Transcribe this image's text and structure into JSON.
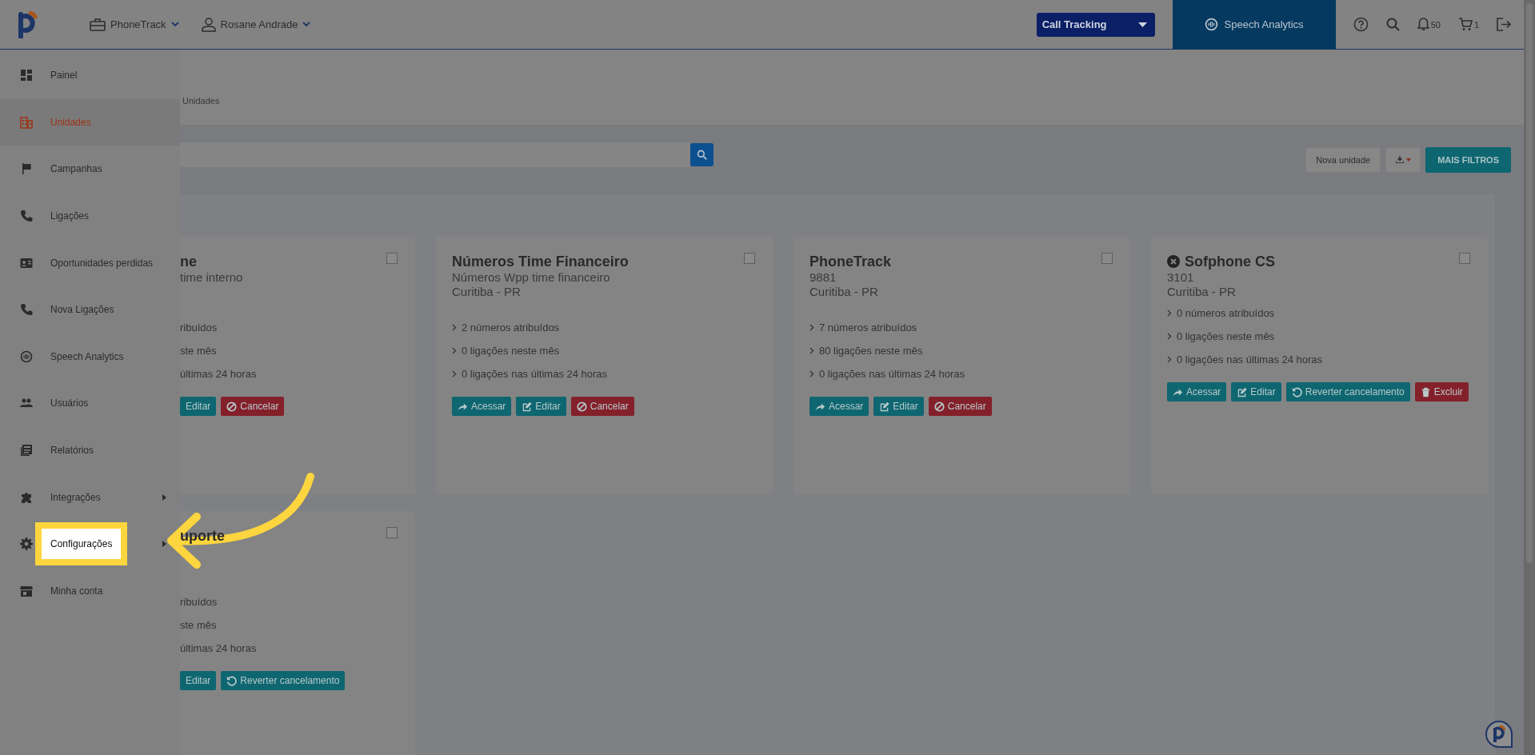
{
  "header": {
    "account": "PhoneTrack",
    "user": "Rosane Andrade",
    "product_select": "Call Tracking",
    "speech_analytics": "Speech Analytics",
    "notifications": "50",
    "cart": "1"
  },
  "sidebar": {
    "items": [
      {
        "label": "Painel",
        "selected": false,
        "submenu": false,
        "highlighted": false
      },
      {
        "label": "Unidades",
        "selected": true,
        "submenu": false,
        "highlighted": false
      },
      {
        "label": "Campanhas",
        "selected": false,
        "submenu": false,
        "highlighted": false
      },
      {
        "label": "Ligações",
        "selected": false,
        "submenu": false,
        "highlighted": false
      },
      {
        "label": "Oportunidades perdidas",
        "selected": false,
        "submenu": false,
        "highlighted": false
      },
      {
        "label": "Nova Ligações",
        "selected": false,
        "submenu": false,
        "highlighted": false
      },
      {
        "label": "Speech Analytics",
        "selected": false,
        "submenu": false,
        "highlighted": false
      },
      {
        "label": "Usuários",
        "selected": false,
        "submenu": false,
        "highlighted": false
      },
      {
        "label": "Relatórios",
        "selected": false,
        "submenu": false,
        "highlighted": false
      },
      {
        "label": "Integrações",
        "selected": false,
        "submenu": true,
        "highlighted": false
      },
      {
        "label": "Configurações",
        "selected": false,
        "submenu": true,
        "highlighted": true
      },
      {
        "label": "Minha conta",
        "selected": false,
        "submenu": false,
        "highlighted": false
      }
    ]
  },
  "breadcrumb": "Unidades",
  "toolbar": {
    "new_button": "Nova unidade",
    "filters_button": "MAIS FILTROS"
  },
  "cards": [
    {
      "kind": "partial",
      "title": "ne",
      "subtitle": "time interno",
      "cancelled": false,
      "checked": false,
      "stats": [
        "ribuídos",
        "ste mês",
        "últimas 24 horas"
      ],
      "buttons": [
        {
          "kind": "edit",
          "label": "Editar"
        },
        {
          "kind": "cancel",
          "label": "Cancelar"
        }
      ]
    },
    {
      "kind": "full",
      "title": "Números Time Financeiro",
      "subtitle": "Números Wpp time financeiro",
      "location": "Curitiba - PR",
      "cancelled": false,
      "checked": false,
      "stats": [
        "2 números atribuídos",
        "0 ligações neste mês",
        "0 ligações nas últimas 24 horas"
      ],
      "buttons": [
        {
          "kind": "access",
          "label": "Acessar"
        },
        {
          "kind": "edit",
          "label": "Editar"
        },
        {
          "kind": "cancel",
          "label": "Cancelar"
        }
      ]
    },
    {
      "kind": "full",
      "title": "PhoneTrack",
      "subtitle": "9881",
      "location": "Curitiba - PR",
      "cancelled": false,
      "checked": false,
      "stats": [
        "7 números atribuídos",
        "80 ligações neste mês",
        "0 ligações nas últimas 24 horas"
      ],
      "buttons": [
        {
          "kind": "access",
          "label": "Acessar"
        },
        {
          "kind": "edit",
          "label": "Editar"
        },
        {
          "kind": "cancel",
          "label": "Cancelar"
        }
      ]
    },
    {
      "kind": "full",
      "title": "Sofphone CS",
      "subtitle": "3101",
      "location": "Curitiba - PR",
      "cancelled": true,
      "checked": false,
      "stats": [
        "0 números atribuídos",
        "0 ligações neste mês",
        "0 ligações nas últimas 24 horas"
      ],
      "buttons": [
        {
          "kind": "access",
          "label": "Acessar"
        },
        {
          "kind": "edit",
          "label": "Editar"
        },
        {
          "kind": "revert",
          "label": "Reverter cancelamento"
        },
        {
          "kind": "delete",
          "label": "Excluir"
        }
      ]
    },
    {
      "kind": "partial",
      "title": "uporte",
      "cancelled": false,
      "checked": false,
      "stats": [
        "ribuídos",
        "ste mês",
        "últimas 24 horas"
      ],
      "buttons": [
        {
          "kind": "edit",
          "label": "Editar"
        },
        {
          "kind": "revert",
          "label": "Reverter cancelamento"
        }
      ]
    }
  ]
}
